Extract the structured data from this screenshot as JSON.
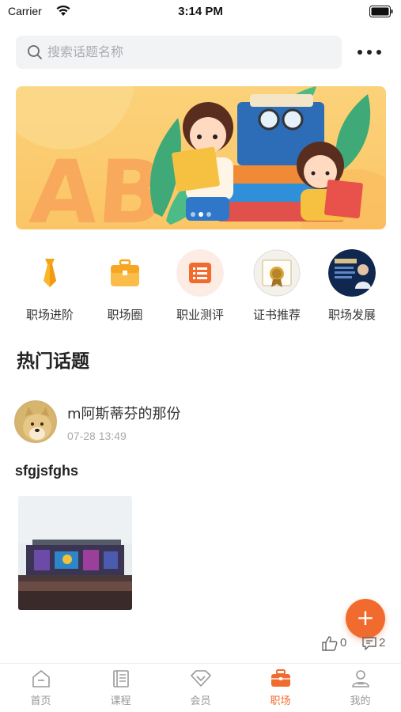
{
  "status_bar": {
    "carrier": "Carrier",
    "time": "3:14 PM"
  },
  "search": {
    "placeholder": "搜索话题名称"
  },
  "banner": {
    "letters": "AB",
    "page_count": 3,
    "active_page": 1
  },
  "categories": [
    {
      "label": "职场进阶",
      "icon": "tie-icon"
    },
    {
      "label": "职场圈",
      "icon": "briefcase-icon"
    },
    {
      "label": "职业测评",
      "icon": "list-icon"
    },
    {
      "label": "证书推荐",
      "icon": "certificate-icon"
    },
    {
      "label": "职场发展",
      "icon": "career-poster-icon"
    }
  ],
  "section": {
    "title": "热门话题"
  },
  "post": {
    "author": "m阿斯蒂芬的那份",
    "time": "07-28 13:49",
    "title": "sfgjsfghs",
    "likes": "0",
    "comments": "2"
  },
  "fab": {
    "label": "+"
  },
  "tabs": [
    {
      "label": "首页",
      "icon": "home-icon"
    },
    {
      "label": "课程",
      "icon": "book-icon"
    },
    {
      "label": "会员",
      "icon": "vip-icon"
    },
    {
      "label": "职场",
      "icon": "briefcase-icon",
      "active": true
    },
    {
      "label": "我的",
      "icon": "user-icon"
    }
  ],
  "colors": {
    "accent": "#f26b2e",
    "banner_bg": "#fbc565",
    "muted": "#999999"
  }
}
